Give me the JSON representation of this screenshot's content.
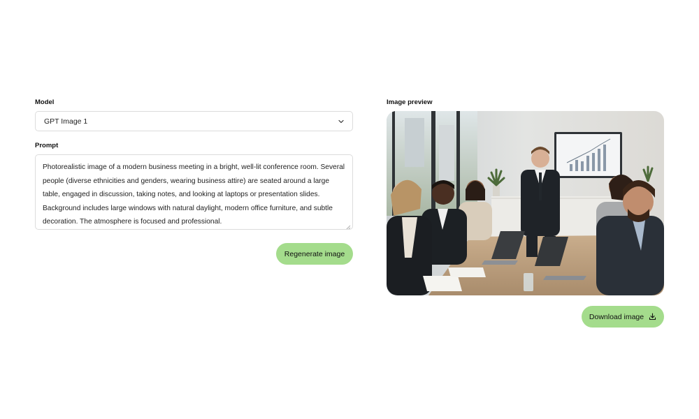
{
  "model": {
    "label": "Model",
    "selected": "GPT Image 1",
    "chevron_icon": "chevron-down-icon"
  },
  "prompt": {
    "label": "Prompt",
    "value": "Photorealistic image of a modern business meeting in a bright, well-lit conference room. Several people (diverse ethnicities and genders, wearing business attire) are seated around a large table, engaged in discussion, taking notes, and looking at laptops or presentation slides. Background includes large windows with natural daylight, modern office furniture, and subtle decoration. The atmosphere is focused and professional."
  },
  "regenerate_button": {
    "label": "Regenerate image"
  },
  "preview": {
    "label": "Image preview",
    "image_description": "photo of business meeting in conference room"
  },
  "download_button": {
    "label": "Download image",
    "icon": "download-icon"
  },
  "colors": {
    "button_bg": "#a4dc8c",
    "border": "#dcdcdc",
    "text": "#111111"
  }
}
